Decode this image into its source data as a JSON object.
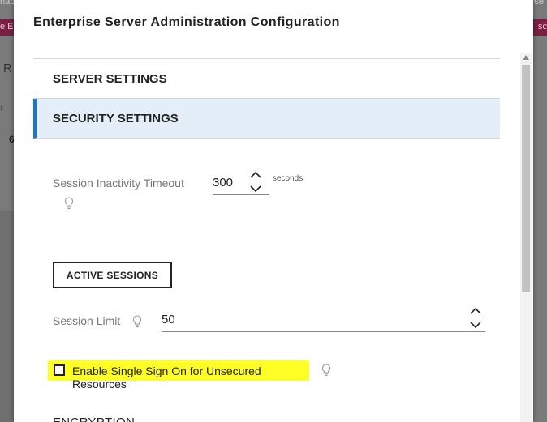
{
  "background": {
    "top_left_text": "nab",
    "banner_text": "e ES",
    "top_right_text": "s se",
    "banner_right_text": "sc",
    "left_letter": "R",
    "left_tick": "›",
    "left_digit": "6"
  },
  "dialog": {
    "title": "Enterprise Server Administration Configuration"
  },
  "sections": {
    "server_settings": "SERVER SETTINGS",
    "security_settings": "SECURITY SETTINGS"
  },
  "session_timeout": {
    "label": "Session Inactivity Timeout",
    "value": "300",
    "unit": "seconds",
    "hint_icon": "lightbulb-icon"
  },
  "active_sessions_button": "ACTIVE SESSIONS",
  "session_limit": {
    "label": "Session Limit",
    "value": "50",
    "hint_icon": "lightbulb-icon"
  },
  "sso": {
    "label": "Enable Single Sign On for Unsecured Resources",
    "checked": false,
    "highlight_color": "#ffff26"
  },
  "next_section": "ENCRYPTION",
  "colors": {
    "accent": "#1976d2",
    "selected_section_bg": "#e4eef9",
    "banner": "#7a1f42"
  }
}
